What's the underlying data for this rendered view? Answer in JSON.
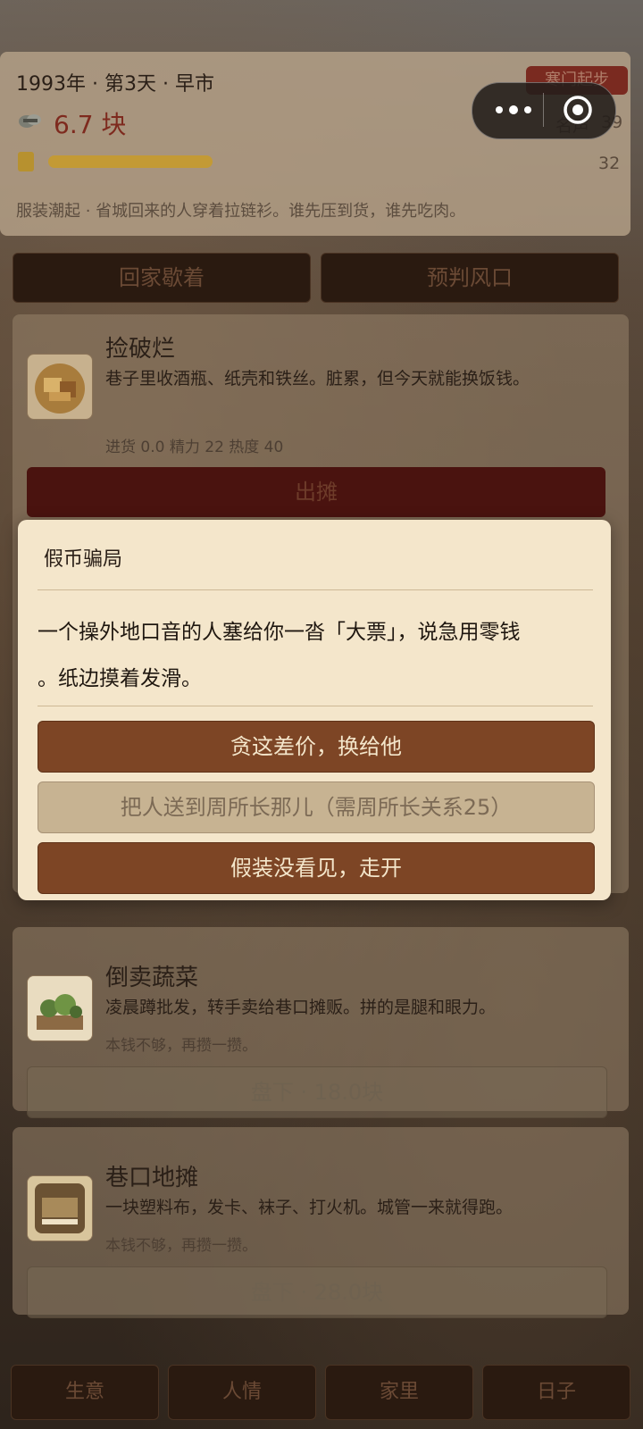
{
  "status": {
    "date_line": "1993年 · 第3天 · 早市",
    "stage_badge": "寒门起步",
    "money": "6.7 块",
    "reputation_label": "名声",
    "reputation_value": "39",
    "stamina_value": "32",
    "stamina_level_percent": 32,
    "news": "服装潮起 · 省城回来的人穿着拉链衫。谁先压到货，谁先吃肉。"
  },
  "capsule": {
    "more_icon": "more-dots-icon",
    "close_icon": "target-close-icon"
  },
  "actions": {
    "rest_label": "回家歇着",
    "predict_label": "预判风口"
  },
  "jobs": [
    {
      "title": "捡破烂",
      "desc": "巷子里收酒瓶、纸壳和铁丝。脏累，但今天就能换饭钱。",
      "meta": "进货 0.0  精力 22  热度 40",
      "button": "出摊",
      "icon": "scrap-basket-icon"
    },
    {
      "title": "倒卖蔬菜",
      "desc": "凌晨蹲批发，转手卖给巷口摊贩。拼的是腿和眼力。",
      "meta": "本钱不够，再攒一攒。",
      "button": "盘下 · 18.0块",
      "icon": "vegetable-stall-icon"
    },
    {
      "title": "巷口地摊",
      "desc": "一块塑料布，发卡、袜子、打火机。城管一来就得跑。",
      "meta": "本钱不够，再攒一攒。",
      "button": "盘下 · 28.0块",
      "icon": "street-stall-icon"
    }
  ],
  "modal": {
    "title": "假币骗局",
    "body_line1": "一个操外地口音的人塞给你一沓「大票」，说急用零钱",
    "body_line2": "。纸边摸着发滑。",
    "options": [
      "贪这差价，换给他",
      "把人送到周所长那儿（需周所长关系25）",
      "假装没看见，走开"
    ]
  },
  "tabs": [
    "生意",
    "人情",
    "家里",
    "日子"
  ],
  "colors": {
    "modal_bg": "#f4e6cb",
    "primary_button": "#7d4525",
    "disabled_button": "#c7b392",
    "money_red": "#7e2a1e",
    "stamina_gold": "#c39a35"
  }
}
